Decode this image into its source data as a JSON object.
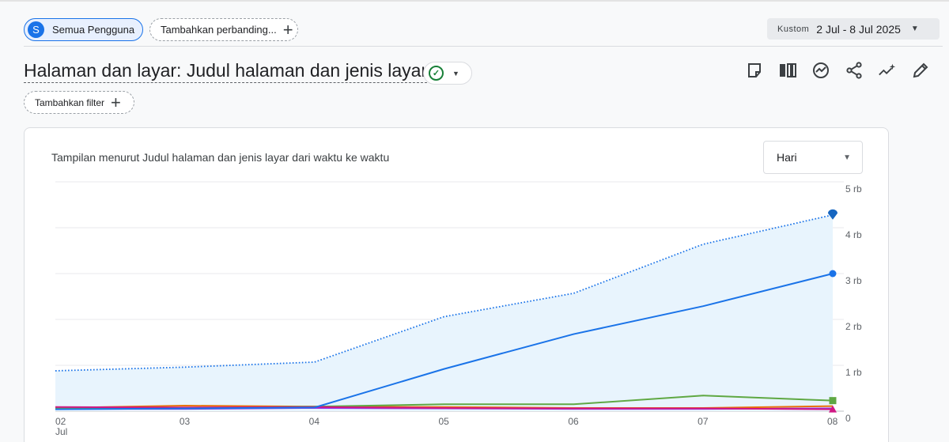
{
  "header": {
    "segment": {
      "avatar_letter": "S",
      "label": "Semua Pengguna"
    },
    "compare_label": "Tambahkan perbanding...",
    "date_range": {
      "label": "Kustom",
      "value": "2 Jul - 8 Jul 2025"
    }
  },
  "report": {
    "title": "Halaman dan layar: Judul halaman dan jenis layar",
    "filter_label": "Tambahkan filter",
    "toolbar_icons": [
      "note-icon",
      "compare-columns-icon",
      "insights-icon",
      "share-icon",
      "sparkle-trend-icon",
      "edit-pencil-icon"
    ]
  },
  "card": {
    "title": "Tampilan menurut Judul halaman dan jenis layar dari waktu ke waktu",
    "granularity": "Hari"
  },
  "chart_data": {
    "type": "line",
    "x": [
      "02",
      "03",
      "04",
      "05",
      "06",
      "07",
      "08"
    ],
    "x_sublabel": "Jul",
    "y_ticks": [
      "0",
      "1 rb",
      "2 rb",
      "3 rb",
      "4 rb",
      "5 rb"
    ],
    "ylim": [
      0,
      5000
    ],
    "grid": true,
    "series": [
      {
        "values": [
          880,
          960,
          1070,
          2060,
          2570,
          3640,
          4280
        ],
        "color": "#1a73e8",
        "style": "dotted",
        "fill": "#e8f4fd",
        "marker": "pin"
      },
      {
        "values": [
          40,
          60,
          80,
          920,
          1680,
          2290,
          3000
        ],
        "color": "#1a73e8",
        "style": "solid",
        "marker": "circle"
      },
      {
        "values": [
          60,
          60,
          100,
          150,
          150,
          340,
          230
        ],
        "color": "#5fa843",
        "style": "solid",
        "marker": "square"
      },
      {
        "values": [
          70,
          120,
          100,
          90,
          70,
          70,
          110
        ],
        "color": "#e8710a",
        "style": "solid",
        "marker": "none"
      },
      {
        "values": [
          90,
          80,
          90,
          70,
          60,
          60,
          40
        ],
        "color": "#d01884",
        "style": "solid",
        "marker": "star"
      },
      {
        "values": [
          50,
          50,
          70,
          60,
          50,
          50,
          60
        ],
        "color": "#9334e6",
        "style": "solid",
        "marker": "none"
      }
    ]
  }
}
